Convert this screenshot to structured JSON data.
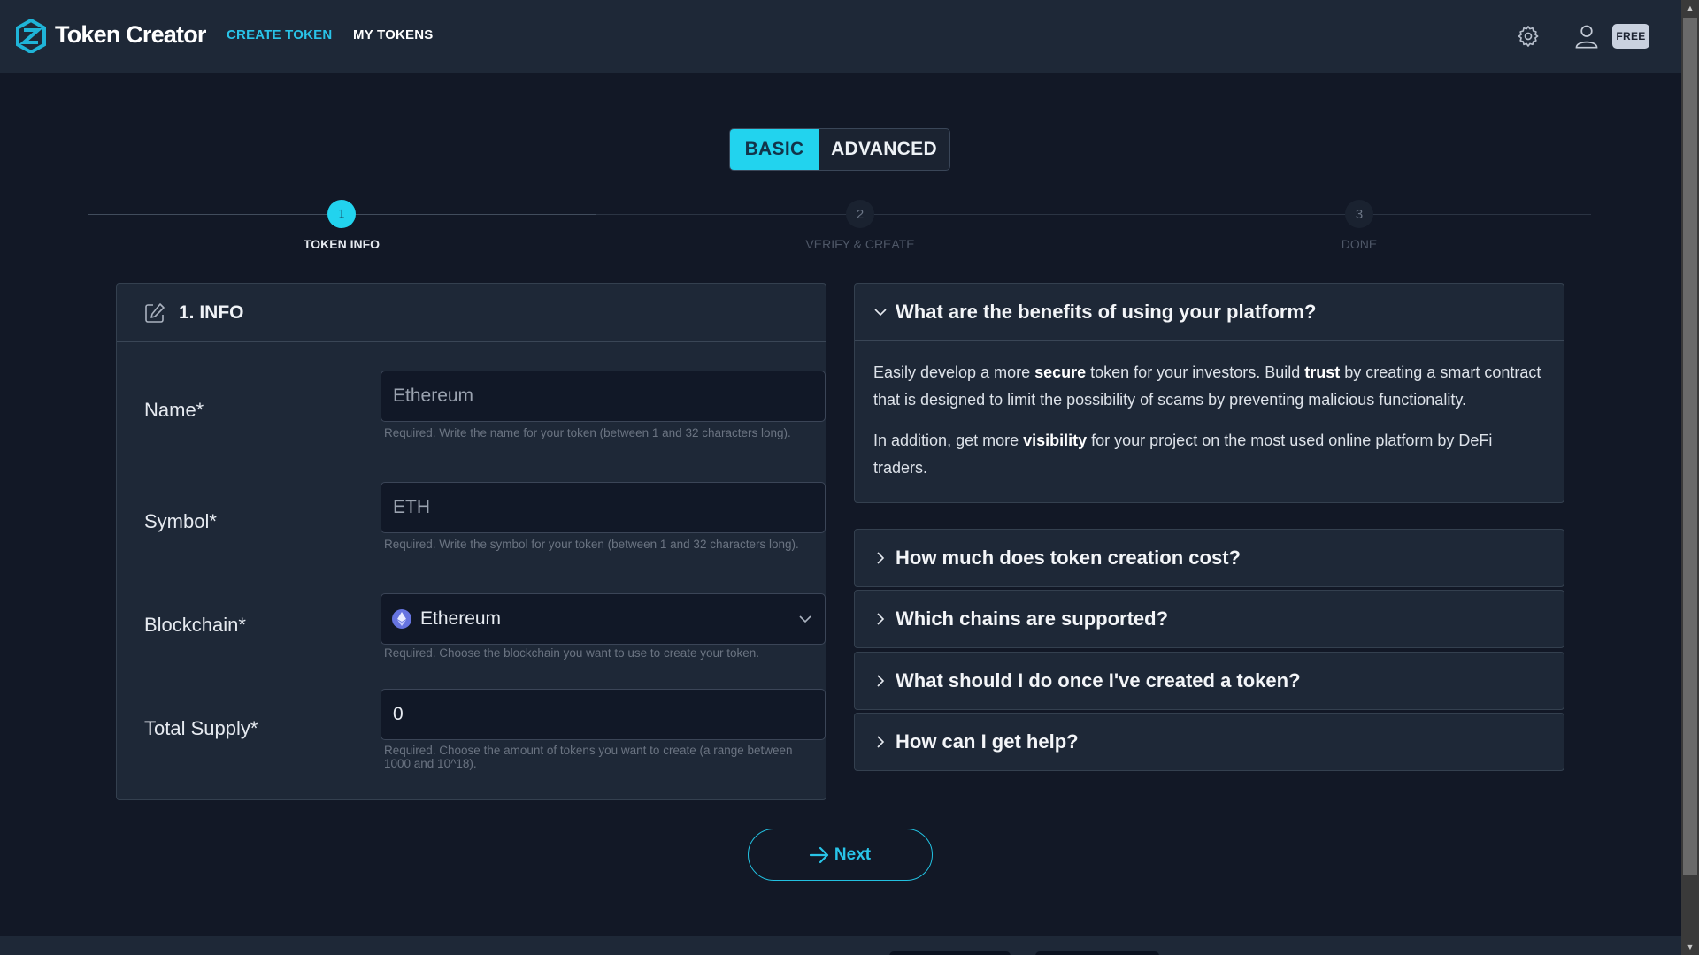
{
  "header": {
    "brand": "Token Creator",
    "nav": [
      {
        "label": "CREATE TOKEN",
        "active": true
      },
      {
        "label": "MY TOKENS",
        "active": false
      }
    ],
    "icons": [
      "settings-gear-icon",
      "user-profile-icon"
    ],
    "plan_badge": "FREE"
  },
  "mode_toggle": {
    "options": [
      "BASIC",
      "ADVANCED"
    ],
    "selected": "BASIC"
  },
  "stepper": {
    "current_step": 1,
    "steps": [
      {
        "number": "1",
        "label": "TOKEN INFO"
      },
      {
        "number": "2",
        "label": "VERIFY & CREATE"
      },
      {
        "number": "3",
        "label": "DONE"
      }
    ]
  },
  "info_card": {
    "title": "1. INFO",
    "icon": "edit-icon",
    "fields": {
      "name": {
        "label": "Name*",
        "value": "",
        "placeholder": "Ethereum",
        "helper": "Required. Write the name for your token (between 1 and 32 characters long)."
      },
      "symbol": {
        "label": "Symbol*",
        "value": "",
        "placeholder": "ETH",
        "helper": "Required. Write the symbol for your token (between 1 and 32 characters long)."
      },
      "blockchain": {
        "label": "Blockchain*",
        "selected": "Ethereum",
        "icon": "ethereum-logo-icon",
        "helper": "Required. Choose the blockchain you want to use to create your token."
      },
      "total_supply": {
        "label": "Total Supply*",
        "value": "0",
        "helper": "Required. Choose the amount of tokens you want to create (a range between 1000 and 10^18)."
      }
    }
  },
  "faq": {
    "items": [
      {
        "question": "What are the benefits of using your platform?",
        "expanded": true,
        "answer": {
          "p1": {
            "a": "Easily develop a more ",
            "b1": "secure",
            "c": " token for your investors. Build ",
            "b2": "trust",
            "d": " by creating a smart contract that is designed to limit the possibility of scams by preventing malicious functionality."
          },
          "p2": {
            "a": "In addition, get more ",
            "b1": "visibility",
            "c": " for your project on the most used online platform by DeFi traders."
          }
        }
      },
      {
        "question": "How much does token creation cost?",
        "expanded": false
      },
      {
        "question": "Which chains are supported?",
        "expanded": false
      },
      {
        "question": "What should I do once I've created a token?",
        "expanded": false
      },
      {
        "question": "How can I get help?",
        "expanded": false
      }
    ]
  },
  "actions": {
    "next_label": "Next"
  },
  "colors": {
    "accent": "#22d3ee",
    "header_bg": "#1e2837",
    "page_bg": "#121826",
    "card_bg": "#1e2837"
  }
}
